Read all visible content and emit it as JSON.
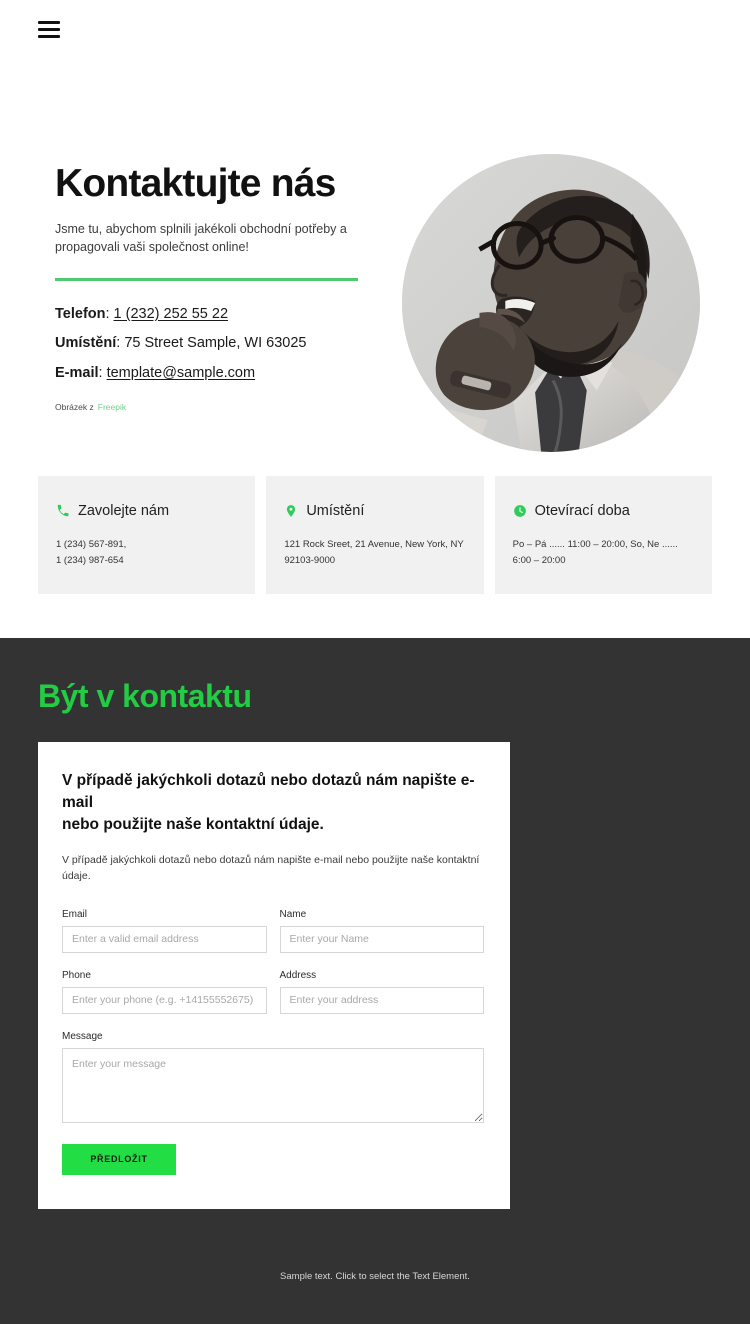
{
  "header": {
    "menu_icon": "hamburger-menu-icon"
  },
  "hero": {
    "title": "Kontaktujte nás",
    "subtitle": "Jsme tu, abychom splnili jakékoli obchodní potřeby a propagovali vaši společnost online!",
    "contacts": [
      {
        "label": "Telefon",
        "separator": ": ",
        "value": "1 (232) 252 55 22",
        "is_link": true
      },
      {
        "label": "Umístění",
        "separator": ": ",
        "value": "75 Street Sample, WI 63025",
        "is_link": false
      },
      {
        "label": "E-mail",
        "separator": ": ",
        "value": "template@sample.com",
        "is_link": true
      }
    ],
    "credit_prefix": "Obrázek z",
    "credit_link": "Freepik",
    "image_alt": "portrait-photo",
    "divider_color": "#4ecb71"
  },
  "cards": [
    {
      "icon": "phone-icon",
      "title": "Zavolejte nám",
      "body": "1 (234) 567-891,\n1 (234) 987-654"
    },
    {
      "icon": "map-pin-icon",
      "title": "Umístění",
      "body": "121 Rock Sreet, 21 Avenue, New York, NY 92103-9000"
    },
    {
      "icon": "clock-icon",
      "title": "Otevírací doba",
      "body": "Po – Pá ...... 11:00 – 20:00, So, Ne  ...... 6:00 – 20:00"
    }
  ],
  "dark_section": {
    "title": "Být v kontaktu",
    "background": "#333333",
    "title_color": "#22cc44",
    "form": {
      "heading": "V případě jakýchkoli dotazů nebo dotazů nám napište e-mail\nnebo použijte naše kontaktní údaje.",
      "description": "V případě jakýchkoli dotazů nebo dotazů nám napište e-mail nebo použijte naše kontaktní údaje.",
      "fields": [
        {
          "name": "email",
          "label": "Email",
          "placeholder": "Enter a valid email address",
          "value": ""
        },
        {
          "name": "name",
          "label": "Name",
          "placeholder": "Enter your Name",
          "value": ""
        },
        {
          "name": "phone",
          "label": "Phone",
          "placeholder": "Enter your phone (e.g. +14155552675)",
          "value": ""
        },
        {
          "name": "address",
          "label": "Address",
          "placeholder": "Enter your address",
          "value": ""
        },
        {
          "name": "message",
          "label": "Message",
          "placeholder": "Enter your message",
          "value": ""
        }
      ],
      "submit_label": "PŘEDLOŽIT",
      "submit_color": "#22dd44"
    }
  },
  "footer": {
    "note": "Sample text. Click to select the Text Element."
  }
}
